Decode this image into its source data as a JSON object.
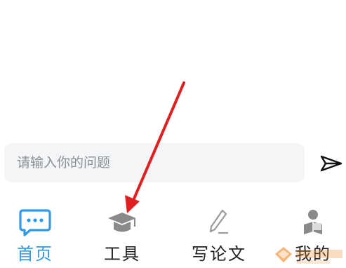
{
  "input": {
    "placeholder": "请输入你的问题"
  },
  "icons": {
    "send": "paper-plane-icon",
    "home": "chat-bubble-icon",
    "tools": "graduation-cap-icon",
    "write": "pen-icon",
    "mine": "user-reading-icon"
  },
  "tabs": [
    {
      "label": "首页",
      "active": true
    },
    {
      "label": "工具",
      "active": false
    },
    {
      "label": "写论文",
      "active": false
    },
    {
      "label": "我的",
      "active": false
    }
  ],
  "colors": {
    "accent": "#2f9be8",
    "annotation_arrow": "#e02020",
    "icon_gray": "#8a8a8a"
  }
}
